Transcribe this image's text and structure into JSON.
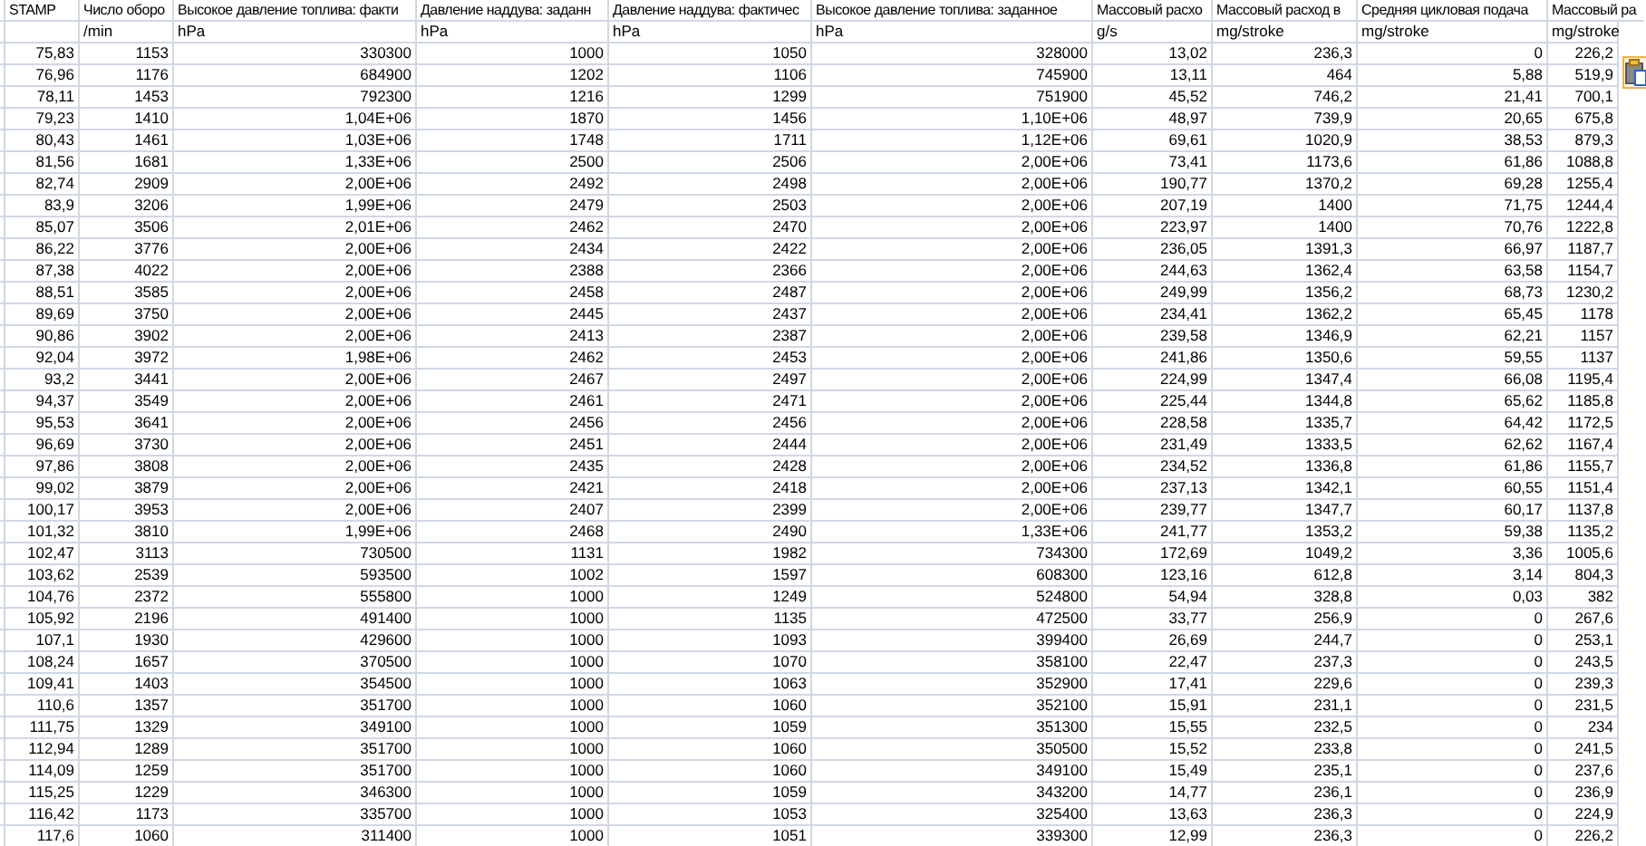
{
  "columns": [
    {
      "header": "STAMP"
    },
    {
      "header": "Число оборо",
      "unit": "/min"
    },
    {
      "header": "Высокое давление топлива: факти",
      "unit": "hPa"
    },
    {
      "header": "Давление наддува: заданн",
      "unit": "hPa"
    },
    {
      "header": "Давление наддува: фактичес",
      "unit": "hPa"
    },
    {
      "header": "Высокое давление топлива: заданное",
      "unit": "hPa"
    },
    {
      "header": "Массовый расхо",
      "unit": "g/s"
    },
    {
      "header": "Массовый расход в",
      "unit": "mg/stroke"
    },
    {
      "header": "Средняя цикловая подача",
      "unit": "mg/stroke"
    },
    {
      "header": "Массовый ра",
      "unit": "mg/stroke"
    }
  ],
  "rows": [
    [
      "75,83",
      "1153",
      "330300",
      "1000",
      "1050",
      "328000",
      "13,02",
      "236,3",
      "0",
      "226,2"
    ],
    [
      "76,96",
      "1176",
      "684900",
      "1202",
      "1106",
      "745900",
      "13,11",
      "464",
      "5,88",
      "519,9"
    ],
    [
      "78,11",
      "1453",
      "792300",
      "1216",
      "1299",
      "751900",
      "45,52",
      "746,2",
      "21,41",
      "700,1"
    ],
    [
      "79,23",
      "1410",
      "1,04E+06",
      "1870",
      "1456",
      "1,10E+06",
      "48,97",
      "739,9",
      "20,65",
      "675,8"
    ],
    [
      "80,43",
      "1461",
      "1,03E+06",
      "1748",
      "1711",
      "1,12E+06",
      "69,61",
      "1020,9",
      "38,53",
      "879,3"
    ],
    [
      "81,56",
      "1681",
      "1,33E+06",
      "2500",
      "2506",
      "2,00E+06",
      "73,41",
      "1173,6",
      "61,86",
      "1088,8"
    ],
    [
      "82,74",
      "2909",
      "2,00E+06",
      "2492",
      "2498",
      "2,00E+06",
      "190,77",
      "1370,2",
      "69,28",
      "1255,4"
    ],
    [
      "83,9",
      "3206",
      "1,99E+06",
      "2479",
      "2503",
      "2,00E+06",
      "207,19",
      "1400",
      "71,75",
      "1244,4"
    ],
    [
      "85,07",
      "3506",
      "2,01E+06",
      "2462",
      "2470",
      "2,00E+06",
      "223,97",
      "1400",
      "70,76",
      "1222,8"
    ],
    [
      "86,22",
      "3776",
      "2,00E+06",
      "2434",
      "2422",
      "2,00E+06",
      "236,05",
      "1391,3",
      "66,97",
      "1187,7"
    ],
    [
      "87,38",
      "4022",
      "2,00E+06",
      "2388",
      "2366",
      "2,00E+06",
      "244,63",
      "1362,4",
      "63,58",
      "1154,7"
    ],
    [
      "88,51",
      "3585",
      "2,00E+06",
      "2458",
      "2487",
      "2,00E+06",
      "249,99",
      "1356,2",
      "68,73",
      "1230,2"
    ],
    [
      "89,69",
      "3750",
      "2,00E+06",
      "2445",
      "2437",
      "2,00E+06",
      "234,41",
      "1362,2",
      "65,45",
      "1178"
    ],
    [
      "90,86",
      "3902",
      "2,00E+06",
      "2413",
      "2387",
      "2,00E+06",
      "239,58",
      "1346,9",
      "62,21",
      "1157"
    ],
    [
      "92,04",
      "3972",
      "1,98E+06",
      "2462",
      "2453",
      "2,00E+06",
      "241,86",
      "1350,6",
      "59,55",
      "1137"
    ],
    [
      "93,2",
      "3441",
      "2,00E+06",
      "2467",
      "2497",
      "2,00E+06",
      "224,99",
      "1347,4",
      "66,08",
      "1195,4"
    ],
    [
      "94,37",
      "3549",
      "2,00E+06",
      "2461",
      "2471",
      "2,00E+06",
      "225,44",
      "1344,8",
      "65,62",
      "1185,8"
    ],
    [
      "95,53",
      "3641",
      "2,00E+06",
      "2456",
      "2456",
      "2,00E+06",
      "228,58",
      "1335,7",
      "64,42",
      "1172,5"
    ],
    [
      "96,69",
      "3730",
      "2,00E+06",
      "2451",
      "2444",
      "2,00E+06",
      "231,49",
      "1333,5",
      "62,62",
      "1167,4"
    ],
    [
      "97,86",
      "3808",
      "2,00E+06",
      "2435",
      "2428",
      "2,00E+06",
      "234,52",
      "1336,8",
      "61,86",
      "1155,7"
    ],
    [
      "99,02",
      "3879",
      "2,00E+06",
      "2421",
      "2418",
      "2,00E+06",
      "237,13",
      "1342,1",
      "60,55",
      "1151,4"
    ],
    [
      "100,17",
      "3953",
      "2,00E+06",
      "2407",
      "2399",
      "2,00E+06",
      "239,77",
      "1347,7",
      "60,17",
      "1137,8"
    ],
    [
      "101,32",
      "3810",
      "1,99E+06",
      "2468",
      "2490",
      "1,33E+06",
      "241,77",
      "1353,2",
      "59,38",
      "1135,2"
    ],
    [
      "102,47",
      "3113",
      "730500",
      "1131",
      "1982",
      "734300",
      "172,69",
      "1049,2",
      "3,36",
      "1005,6"
    ],
    [
      "103,62",
      "2539",
      "593500",
      "1002",
      "1597",
      "608300",
      "123,16",
      "612,8",
      "3,14",
      "804,3"
    ],
    [
      "104,76",
      "2372",
      "555800",
      "1000",
      "1249",
      "524800",
      "54,94",
      "328,8",
      "0,03",
      "382"
    ],
    [
      "105,92",
      "2196",
      "491400",
      "1000",
      "1135",
      "472500",
      "33,77",
      "256,9",
      "0",
      "267,6"
    ],
    [
      "107,1",
      "1930",
      "429600",
      "1000",
      "1093",
      "399400",
      "26,69",
      "244,7",
      "0",
      "253,1"
    ],
    [
      "108,24",
      "1657",
      "370500",
      "1000",
      "1070",
      "358100",
      "22,47",
      "237,3",
      "0",
      "243,5"
    ],
    [
      "109,41",
      "1403",
      "354500",
      "1000",
      "1063",
      "352900",
      "17,41",
      "229,6",
      "0",
      "239,3"
    ],
    [
      "110,6",
      "1357",
      "351700",
      "1000",
      "1060",
      "352100",
      "15,91",
      "231,1",
      "0",
      "231,5"
    ],
    [
      "111,75",
      "1329",
      "349100",
      "1000",
      "1059",
      "351300",
      "15,55",
      "232,5",
      "0",
      "234"
    ],
    [
      "112,94",
      "1289",
      "351700",
      "1000",
      "1060",
      "350500",
      "15,52",
      "233,8",
      "0",
      "241,5"
    ],
    [
      "114,09",
      "1259",
      "351700",
      "1000",
      "1060",
      "349100",
      "15,49",
      "235,1",
      "0",
      "237,6"
    ],
    [
      "115,25",
      "1229",
      "346300",
      "1000",
      "1059",
      "343200",
      "14,77",
      "236,1",
      "0",
      "236,9"
    ],
    [
      "116,42",
      "1173",
      "335700",
      "1000",
      "1053",
      "325400",
      "13,63",
      "236,3",
      "0",
      "224,9"
    ],
    [
      "117,6",
      "1060",
      "311400",
      "1000",
      "1051",
      "339300",
      "12,99",
      "236,3",
      "0",
      "226,2"
    ]
  ]
}
